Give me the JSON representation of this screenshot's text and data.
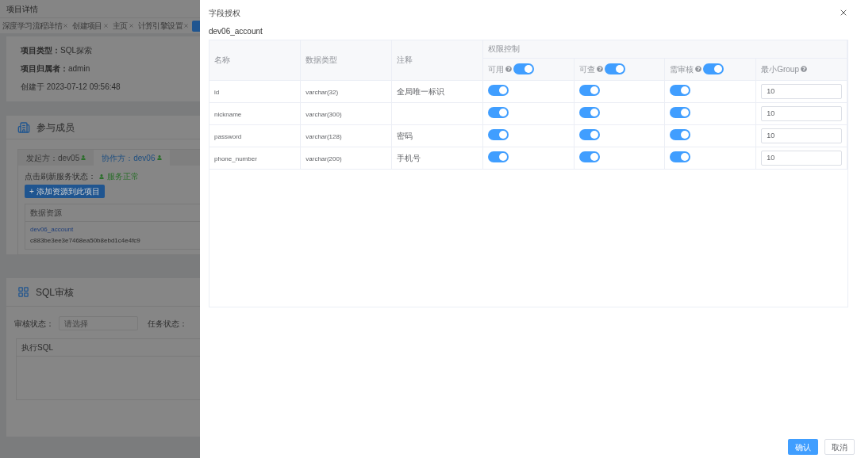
{
  "background": {
    "title": "项目详情",
    "tabs": [
      {
        "label": "深度学习流程详情",
        "selected": false
      },
      {
        "label": "创建项目",
        "selected": false
      },
      {
        "label": "主页",
        "selected": false
      },
      {
        "label": "计算引擎设置",
        "selected": false
      },
      {
        "selected": true
      }
    ],
    "project_card": {
      "fields": [
        {
          "label": "项目类型：",
          "value": "SQL探索"
        },
        {
          "label": "项目归属者：",
          "value": "admin"
        }
      ],
      "created": "创建于 2023-07-12 09:56:48"
    },
    "members_card": {
      "title": "参与成员",
      "tabs": [
        {
          "label": "发起方：dev05",
          "selected": false
        },
        {
          "label": "协作方：dev06",
          "selected": true
        }
      ],
      "status_label": "点击刷新服务状态：",
      "status": "服务正常",
      "add_button": "+ 添加资源到此项目",
      "table_header": "数据资源",
      "resource_name": "dev06_account",
      "resource_id": "c883be3ee3e7468ea50b8ebd1c4e4fc9"
    },
    "sql_card": {
      "title": "SQL审核",
      "filters": [
        {
          "label": "审核状态：",
          "placeholder": "请选择"
        },
        {
          "label": "任务状态："
        }
      ],
      "table_header": "执行SQL"
    }
  },
  "drawer": {
    "title": "字段授权",
    "table_name": "dev06_account",
    "group_header": "权限控制",
    "columns": [
      "名称",
      "数据类型",
      "注释"
    ],
    "permission_columns": [
      {
        "kind": "switch",
        "label": "可用",
        "on": true
      },
      {
        "kind": "switch",
        "label": "可查",
        "on": true
      },
      {
        "kind": "switch",
        "label": "需审核",
        "on": true
      },
      {
        "kind": "number",
        "label": "最小Group"
      }
    ],
    "rows": [
      {
        "name": "id",
        "type": "varchar(32)",
        "comment": "全局唯一标识",
        "permissions": [
          true,
          true,
          true,
          "10"
        ]
      },
      {
        "name": "nickname",
        "type": "varchar(300)",
        "permissions": [
          true,
          true,
          true,
          "10"
        ]
      },
      {
        "name": "password",
        "type": "varchar(128)",
        "comment": "密码",
        "permissions": [
          true,
          true,
          true,
          "10"
        ]
      },
      {
        "name": "phone_number",
        "type": "varchar(200)",
        "comment": "手机号",
        "permissions": [
          true,
          true,
          true,
          "10"
        ]
      }
    ],
    "buttons": [
      {
        "kind": "primary",
        "label": "确认"
      },
      {
        "kind": "default",
        "label": "取消"
      }
    ]
  }
}
